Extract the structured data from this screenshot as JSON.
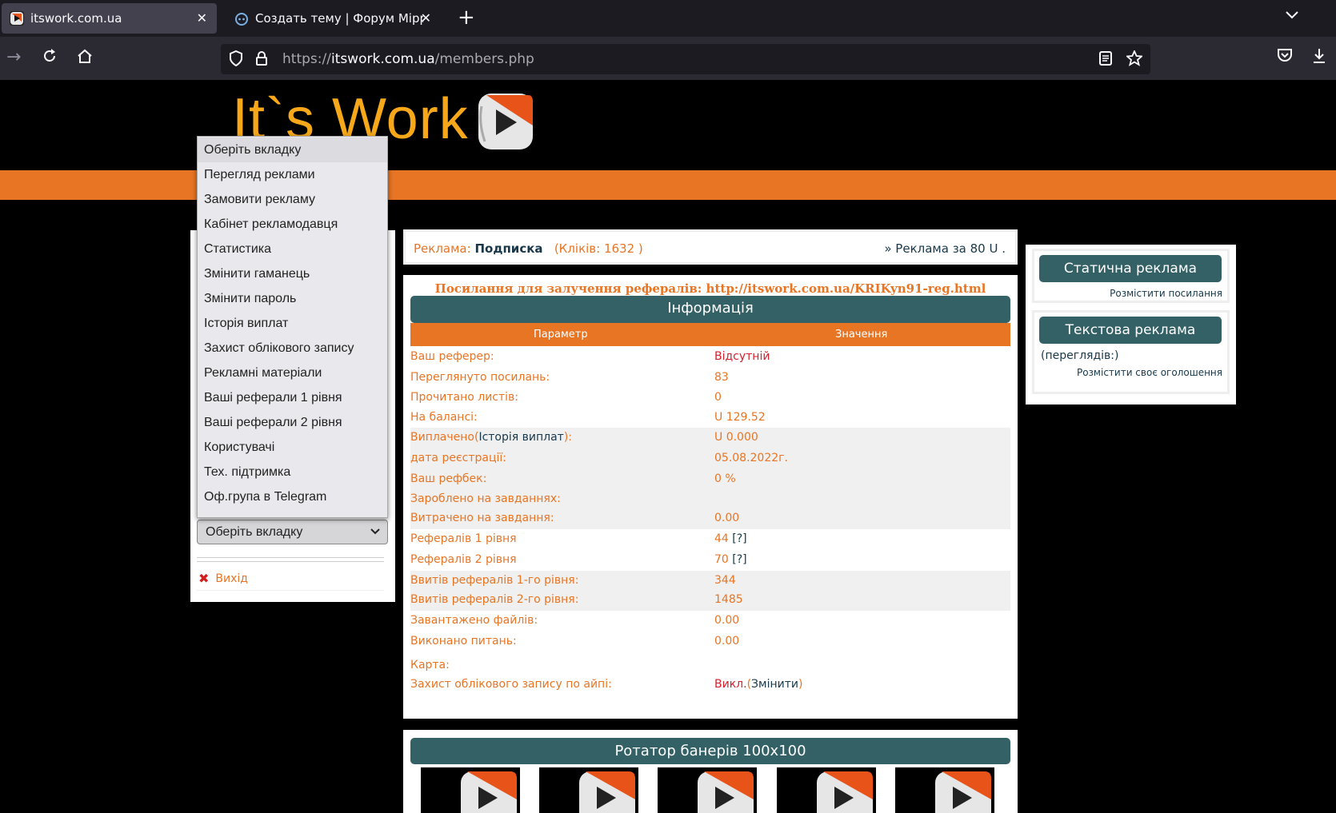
{
  "browser": {
    "tabs": [
      {
        "title": "itswork.com.ua"
      },
      {
        "title": "Создать тему | Форум Mipped"
      }
    ],
    "url_scheme": "https://",
    "url_host": "itswork.com.ua",
    "url_path": "/members.php"
  },
  "logo": {
    "text": "It`s Work"
  },
  "menu": {
    "items": [
      "Оберіть вкладку",
      "Перегляд реклами",
      "Замовити рекламу",
      "Кабінет рекламодавця",
      "Статистика",
      "Змінити гаманець",
      "Змінити пароль",
      "Історія виплат",
      "Захист облікового запису",
      "Рекламні матеріали",
      "Ваші реферали 1 рівня",
      "Ваші реферали 2 рівня",
      "Користувачі",
      "Тех. підтримка",
      "Оф.група в Telegram"
    ],
    "selected": "Оберіть вкладку",
    "exit_label": "Вихід"
  },
  "adbar": {
    "label": "Реклама:",
    "name": "Подписка",
    "clicks": "(Кліків: 1632 )",
    "right": "» Реклама за 80 U ."
  },
  "info": {
    "ref_link": "Посилання для залучення рефералів: http://itswork.com.ua/KRIKyn91-reg.html",
    "title": "Інформація",
    "col_param": "Параметр",
    "col_value": "Значення",
    "rows": [
      {
        "p": "Ваш реферер:",
        "v": "Відсутній"
      },
      {
        "p": "Переглянуто посилань:",
        "v": "83"
      },
      {
        "p": "Прочитано листів:",
        "v": "0"
      },
      {
        "p": "На балансі:",
        "v": "U 129.52"
      },
      {
        "p1": "Виплачено(",
        "plink": "Історія виплат",
        "p2": "):",
        "v": "U 0.000"
      },
      {
        "p": "дата реєстрації:",
        "v": "05.08.2022г."
      },
      {
        "p": "Ваш рефбек:",
        "v": "0 %"
      },
      {
        "p": "Зароблено на завданнях:",
        "v": ""
      },
      {
        "p": "Витрачено на завдання:",
        "v": "0.00"
      },
      {
        "p": "Рефералів 1 рівня",
        "v": "44",
        "hint": "[?]"
      },
      {
        "p": "Рефералів 2 рівня",
        "v": "70",
        "hint": "[?]"
      },
      {
        "p": "Ввитів рефералів 1-го рівня:",
        "v": "344"
      },
      {
        "p": "Ввитів рефералів 2-го рівня:",
        "v": "1485"
      },
      {
        "p": "Завантажено файлів:",
        "v": "0.00"
      },
      {
        "p": "Виконано питань:",
        "v": "0.00"
      },
      {
        "p": "Карта:",
        "v": ""
      },
      {
        "p": "Захист облікового запису по айпі:",
        "v1": "Викл.",
        "v2": "(",
        "vlink": "Змінити",
        "v3": ")"
      }
    ]
  },
  "right": {
    "static_title": "Статична реклама",
    "static_link": "Розмістити посилання",
    "text_title": "Текстова реклама",
    "text_views": "(переглядів:)",
    "text_link": "Розмістити своє оголошення"
  },
  "rotator": {
    "title": "Ротатор банерів 100x100"
  },
  "colors": {
    "accent": "#e87524",
    "teal": "#336166",
    "logo": "#f6a81a"
  }
}
